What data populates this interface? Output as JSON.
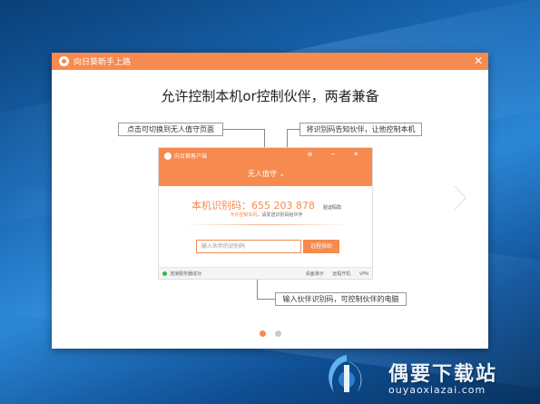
{
  "window": {
    "title": "向日葵新手上路",
    "close_glyph": "✕"
  },
  "headline": "允许控制本机or控制伙伴，两者兼备",
  "callouts": {
    "left_top": "点击可切换到无人值守页面",
    "right_top": "将识别码告知伙伴，让他控制本机",
    "bottom": "输入伙伴识别码，可控制伙伴的电脑"
  },
  "mini_app": {
    "title": "向日葵客户端",
    "window_controls": "⊛ ─ ✕",
    "mode_label": "无人值守",
    "mode_icon": "chevron-down-icon",
    "code_label": "本机识别码：655 203 878",
    "code_note": "验证码隐",
    "sub_accent": "允许控制本机",
    "sub_text": "，请发送识别码给伙伴",
    "input_placeholder": "输入伙伴的识别码",
    "remote_button": "远程协助",
    "status_text": "连接服务器成功",
    "tools": [
      "桌面演示",
      "远程开机",
      "VPN"
    ]
  },
  "pager": {
    "pages": 2,
    "active": 0
  },
  "icons": {
    "next": "chevron-right-icon",
    "logo": "sunflower-logo-icon"
  },
  "watermark": {
    "text": "偶要下载站",
    "url": "ouyaoxiazai.com"
  },
  "colors": {
    "accent": "#f68a4f",
    "desktop": "#1a6bb8"
  }
}
